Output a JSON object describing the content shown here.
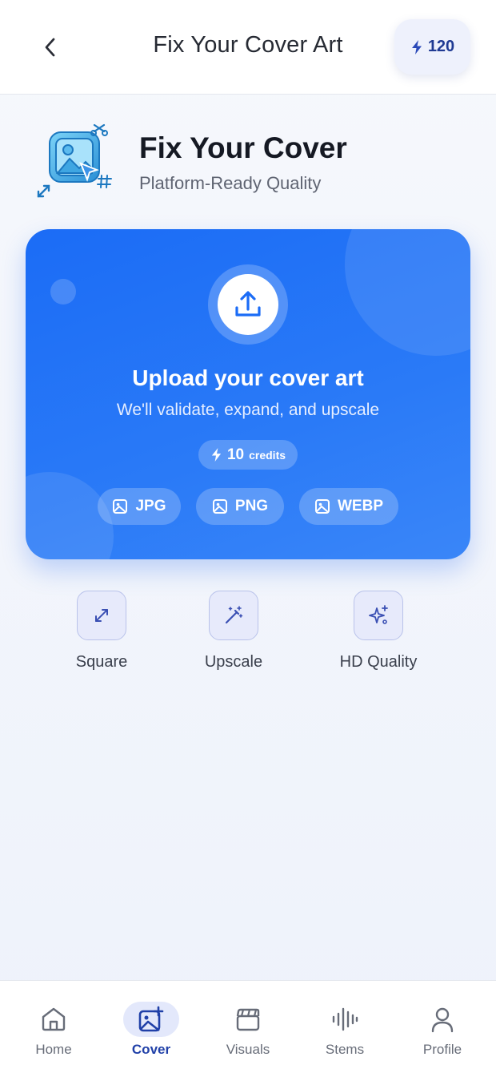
{
  "header": {
    "title": "Fix Your Cover Art",
    "credits": "120",
    "back_icon": "chevron-left-icon",
    "credits_icon": "bolt-icon"
  },
  "hero": {
    "title": "Fix Your Cover",
    "subtitle": "Platform-Ready Quality",
    "icon": "image-edit-icon"
  },
  "upload": {
    "title": "Upload your cover art",
    "subtitle": "We'll validate, expand, and upscale",
    "cost_value": "10",
    "cost_unit": "credits",
    "formats": [
      "JPG",
      "PNG",
      "WEBP"
    ],
    "icon": "upload-icon"
  },
  "features": [
    {
      "label": "Square",
      "icon": "expand-icon"
    },
    {
      "label": "Upscale",
      "icon": "magic-wand-icon"
    },
    {
      "label": "HD Quality",
      "icon": "sparkles-icon"
    }
  ],
  "nav": {
    "items": [
      {
        "label": "Home",
        "icon": "home-icon"
      },
      {
        "label": "Cover",
        "icon": "image-plus-icon",
        "active": true
      },
      {
        "label": "Visuals",
        "icon": "clapperboard-icon"
      },
      {
        "label": "Stems",
        "icon": "waveform-icon"
      },
      {
        "label": "Profile",
        "icon": "user-icon"
      }
    ]
  },
  "colors": {
    "accent": "#1b6cf6",
    "nav_active": "#2040a8",
    "icon_color": "#3a4fb3"
  }
}
